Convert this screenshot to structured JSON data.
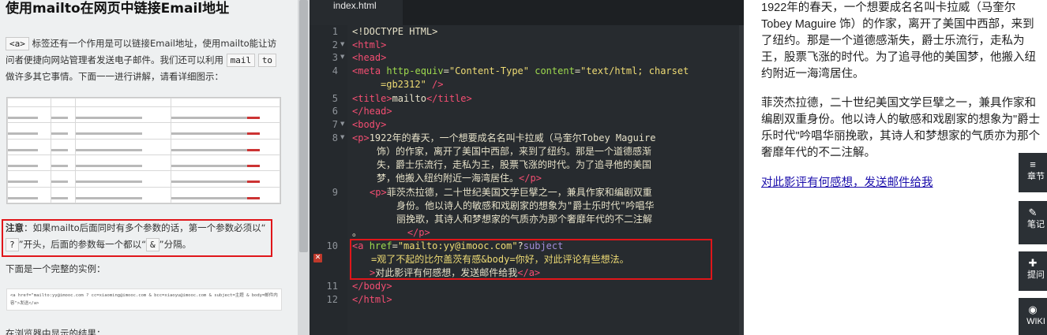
{
  "lesson": {
    "title": "使用mailto在网页中链接Email地址",
    "intro": {
      "chip_a": "<a>",
      "text1": "标签还有一个作用是可以链接Email地址，使用mailto能让访问者便捷向网站管理者发送电子邮件。我们还可以利用",
      "chip_mailto_1": "mail",
      "chip_mailto_2": "to",
      "text2": "做许多其它事情。下面一一进行讲解，请看详细图示："
    },
    "note": {
      "label": "注意",
      "text1": "：如果mailto后面同时有多个参数的话，第一个参数必须以“",
      "chip_q": "?",
      "text2": "”开头，后面的参数每一个都以“",
      "chip_amp": "&",
      "text3": "”分隔。"
    },
    "example_heading": "下面是一个完整的实例：",
    "example_code": "<a href=\"mailto:yy@imooc.com ? cc=xiaoming@imooc.com & bcc=xiaoyu@imooc.com & subject=主题 & body=邮件内容\">发送</a>",
    "cut_text": "在浏览器中显示的结果："
  },
  "editor": {
    "tab": "index.html",
    "lines": [
      "1",
      "2",
      "3",
      "4",
      "",
      "5",
      "6",
      "7",
      "8",
      "",
      "",
      "",
      "9",
      "",
      "",
      "10",
      "",
      "",
      "11",
      "12"
    ],
    "code": {
      "l1": "<!DOCTYPE HTML>",
      "l2": "<html>",
      "l3": "<head>",
      "l4_tag": "<meta",
      "l4_a1": "http-equiv",
      "l4_v1": "\"Content-Type\"",
      "l4_a2": "content",
      "l4_v2a": "\"text/html; charset",
      "l4_v2b": "=gb2312\"",
      "l4_end": "/>",
      "l5_open": "<title>",
      "l5_text": "mailto",
      "l5_close": "</title>",
      "l6": "</head>",
      "l7": "<body>",
      "p1_open": "<p>",
      "p1_text1": "1922年的春天，一个想要成名名叫卡拉威（马奎尔Tobey Maguire",
      "p1_text2": "饰）的作家，离开了美国中西部，来到了纽约。那是一个道德感渐",
      "p1_text3": "失，爵士乐流行，走私为王，股票飞涨的时代。为了追寻他的美国",
      "p1_text4": "梦，他搬入纽约附近一海湾居住。",
      "p1_close": "</p>",
      "p2_open": "<p>",
      "p2_text1": "菲茨杰拉德，二十世纪美国文学巨擘之一，兼具作家和编剧双重",
      "p2_text2": "身份。他以诗人的敏感和戏剧家的想象为\"爵士乐时代\"吟唱华",
      "p2_text3": "丽挽歌，其诗人和梦想家的气质亦为那个奢靡年代的不二注解",
      "p2_text4": "。",
      "p2_close": "</p>",
      "a_tag": "<a",
      "a_attr": "href",
      "a_val": "\"mailto:yy@imooc.com\"",
      "a_q": "?",
      "a_subject": "subject",
      "a_rest": "=观了不起的比尔盖茨有感&body=你好，对此评论有些想法。",
      "a_gt": ">",
      "a_text": "对此影评有何感想，发送邮件给我",
      "a_close": "</a>",
      "l11": "</body>",
      "l12": "</html>"
    }
  },
  "preview": {
    "p1": "1922年的春天，一个想要成名名叫卡拉威（马奎尔Tobey Maguire 饰）的作家，离开了美国中西部，来到了纽约。那是一个道德感渐失，爵士乐流行，走私为王，股票飞涨的时代。为了追寻他的美国梦，他搬入纽约附近一海湾居住。",
    "p2": "菲茨杰拉德，二十世纪美国文学巨擘之一，兼具作家和编剧双重身份。他以诗人的敏感和戏剧家的想象为\"爵士乐时代\"吟唱华丽挽歌，其诗人和梦想家的气质亦为那个奢靡年代的不二注解。",
    "link": "对此影评有何感想，发送邮件给我"
  },
  "sidebar_tools": [
    {
      "icon": "list-icon",
      "label": "章节"
    },
    {
      "icon": "pencil-icon",
      "label": "笔记"
    },
    {
      "icon": "question-icon",
      "label": "提问"
    },
    {
      "icon": "wiki-icon",
      "label": "WIKI"
    }
  ]
}
